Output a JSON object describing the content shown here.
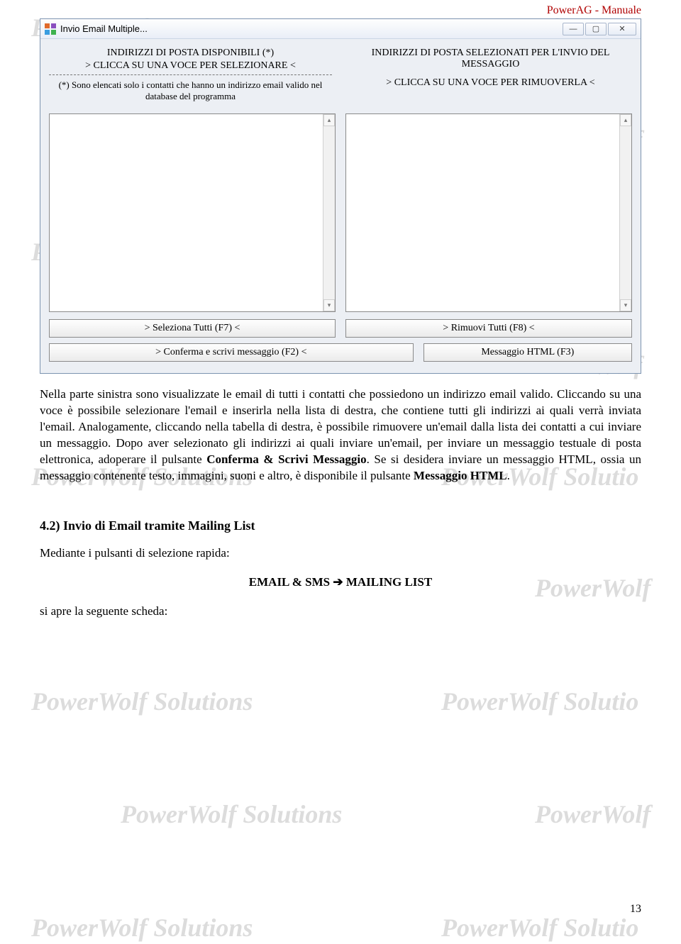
{
  "doc": {
    "header": "PowerAG - Manuale",
    "page_number": "13"
  },
  "watermarks": {
    "left": "PowerWolf Solutions",
    "right_full": "PowerWolf Solutio",
    "right_short": "PowerWolf",
    "right_frag": "rWolf"
  },
  "window": {
    "title": "Invio Email Multiple...",
    "left_header": {
      "l1": "INDIRIZZI DI POSTA DISPONIBILI (*)",
      "l2": "> CLICCA SU UNA VOCE PER SELEZIONARE <",
      "sub": "(*) Sono elencati solo i contatti che hanno un indirizzo email valido nel database del programma"
    },
    "right_header": {
      "l1": "INDIRIZZI DI POSTA SELEZIONATI PER L'INVIO DEL MESSAGGIO",
      "l2": "> CLICCA SU UNA VOCE PER RIMUOVERLA <"
    },
    "buttons": {
      "select_all": ">   Seleziona Tutti  (F7)  <",
      "remove_all": ">   Rimuovi Tutti (F8)  <",
      "confirm": ">   Conferma e scrivi messaggio  (F2)  <",
      "html": "Messaggio HTML  (F3)"
    }
  },
  "body": {
    "p1a": "Nella parte sinistra sono visualizzate le email di tutti i contatti che possiedono un indirizzo email valido. Cliccando su una voce è possibile selezionare l'email e inserirla nella lista di destra, che contiene tutti gli indirizzi ai quali verrà inviata l'email. Analogamente, cliccando nella tabella di destra, è possibile rimuovere un'email dalla lista dei contatti a cui inviare un messaggio. Dopo aver selezionato gli indirizzi ai quali inviare un'email, per inviare un messaggio testuale di posta elettronica, adoperare il pulsante ",
    "p1b": "Conferma & Scrivi Messaggio",
    "p1c": ". Se si desidera inviare un messaggio HTML, ossia un messaggio contenente testo, immagini, suoni e altro, è disponibile il pulsante ",
    "p1d": "Messaggio HTML",
    "p1e": ".",
    "h2": "4.2) Invio di Email tramite Mailing List",
    "p2": "Mediante i pulsanti di selezione rapida:",
    "nav": "EMAIL & SMS ➔ MAILING LIST",
    "p3": "si apre la seguente scheda:"
  }
}
